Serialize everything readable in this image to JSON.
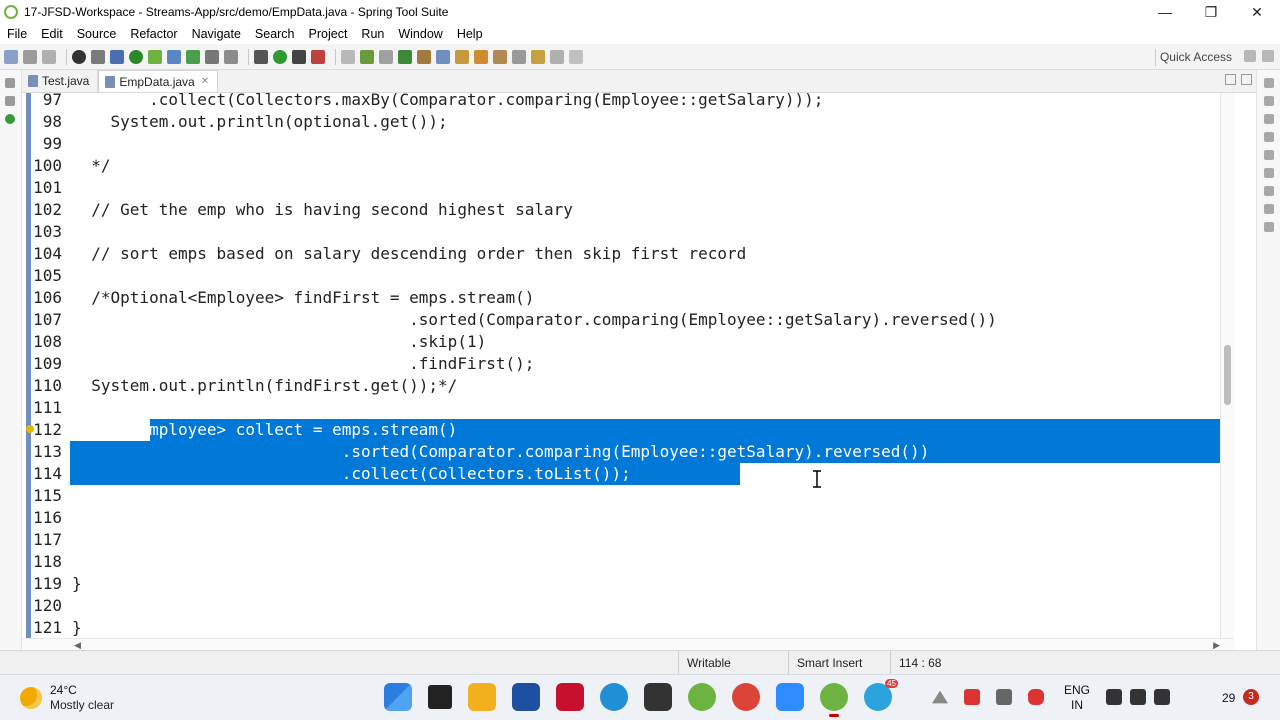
{
  "window": {
    "title": "17-JFSD-Workspace - Streams-App/src/demo/EmpData.java - Spring Tool Suite",
    "controls": [
      "—",
      "❐",
      "✕"
    ]
  },
  "menu": [
    "File",
    "Edit",
    "Source",
    "Refactor",
    "Navigate",
    "Search",
    "Project",
    "Run",
    "Window",
    "Help"
  ],
  "toolbar": {
    "quick_access": "Quick Access"
  },
  "tabs": [
    {
      "label": "Test.java",
      "active": false
    },
    {
      "label": "EmpData.java",
      "active": true,
      "close": "✕"
    }
  ],
  "editor": {
    "lines": [
      {
        "num": "97",
        "code": "        .collect(Collectors.maxBy(Comparator.comparing(Employee::getSalary)));"
      },
      {
        "num": "98",
        "code": "    System.out.println(optional.get());"
      },
      {
        "num": "99",
        "code": ""
      },
      {
        "num": "100",
        "code": "  */"
      },
      {
        "num": "101",
        "code": ""
      },
      {
        "num": "102",
        "code": "  // Get the emp who is having second highest salary"
      },
      {
        "num": "103",
        "code": ""
      },
      {
        "num": "104",
        "code": "  // sort emps based on salary descending order then skip first record"
      },
      {
        "num": "105",
        "code": ""
      },
      {
        "num": "106",
        "code": "  /*Optional<Employee> findFirst = emps.stream()"
      },
      {
        "num": "107",
        "code": "                                   .sorted(Comparator.comparing(Employee::getSalary).reversed())"
      },
      {
        "num": "108",
        "code": "                                   .skip(1)"
      },
      {
        "num": "109",
        "code": "                                   .findFirst();"
      },
      {
        "num": "110",
        "code": "  System.out.println(findFirst.get());*/"
      },
      {
        "num": "111",
        "code": ""
      },
      {
        "num": "112",
        "code": "  List<Employee> collect = emps.stream()"
      },
      {
        "num": "113",
        "code": "                            .sorted(Comparator.comparing(Employee::getSalary).reversed())"
      },
      {
        "num": "114",
        "code": "                            .collect(Collectors.toList());"
      },
      {
        "num": "115",
        "code": ""
      },
      {
        "num": "116",
        "code": ""
      },
      {
        "num": "117",
        "code": ""
      },
      {
        "num": "118",
        "code": ""
      },
      {
        "num": "119",
        "code": "}"
      },
      {
        "num": "120",
        "code": ""
      },
      {
        "num": "121",
        "code": "}"
      }
    ]
  },
  "status": {
    "writable": "Writable",
    "insert_mode": "Smart Insert",
    "position": "114 : 68"
  },
  "taskbar": {
    "weather_temp": "24°C",
    "weather_desc": "Mostly clear",
    "lang_line1": "ENG",
    "lang_line2": "IN",
    "clock": "29",
    "notifications": "3",
    "telegram_badge": "45"
  }
}
